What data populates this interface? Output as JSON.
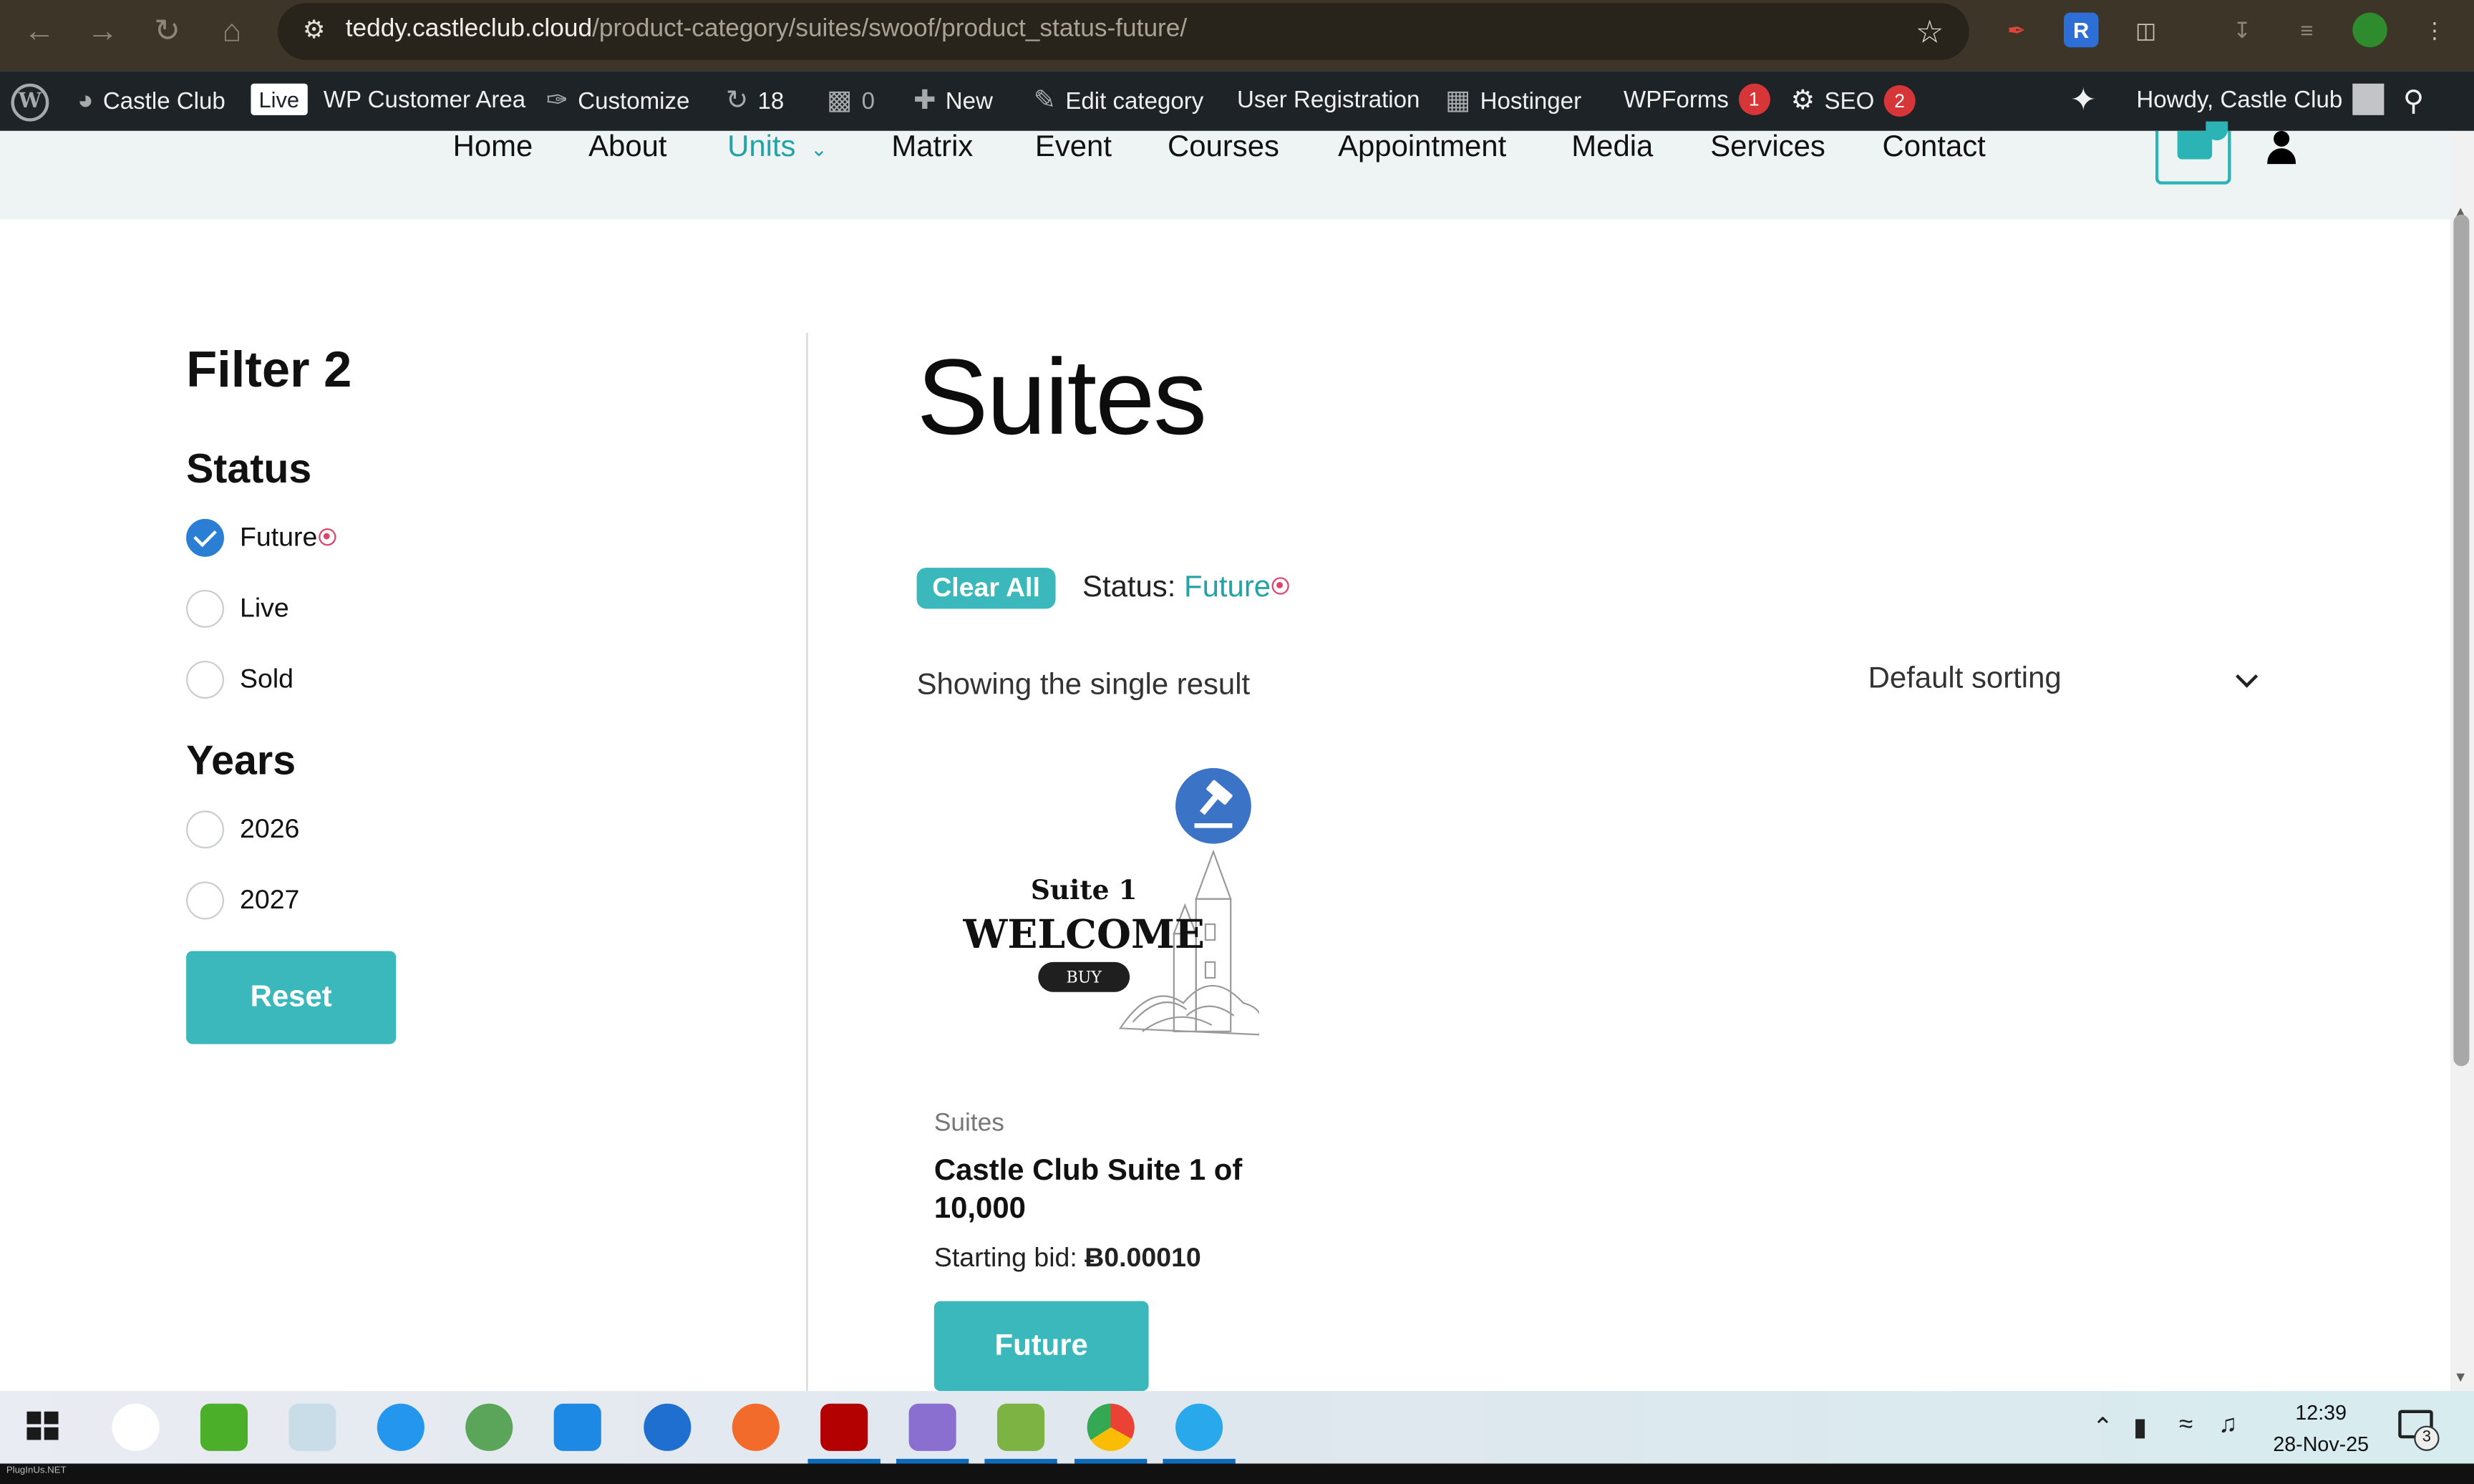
{
  "browser": {
    "url_host": "teddy.castleclub.cloud",
    "url_path": "/product-category/suites/swoof/product_status-future/"
  },
  "wp_admin_bar": {
    "site_name": "Castle Club",
    "live_badge": "Live",
    "customer_area": "WP Customer Area",
    "customize": "Customize",
    "updates_count": "18",
    "comments_count": "0",
    "new_label": "New",
    "edit_category": "Edit category",
    "user_registration": "User Registration",
    "hostinger": "Hostinger",
    "wpforms": "WPForms",
    "wpforms_badge": "1",
    "seo": "SEO",
    "seo_badge": "2",
    "howdy": "Howdy, Castle Club"
  },
  "site_nav": {
    "items": [
      "Home",
      "About",
      "Units",
      "Matrix",
      "Event",
      "Courses",
      "Appointment",
      "Media",
      "Services",
      "Contact"
    ],
    "active": "Units"
  },
  "sidebar": {
    "title": "Filter 2",
    "status_title": "Status",
    "status_options": [
      {
        "label": "Future",
        "checked": true
      },
      {
        "label": "Live",
        "checked": false
      },
      {
        "label": "Sold",
        "checked": false
      }
    ],
    "years_title": "Years",
    "year_options": [
      {
        "label": "2026",
        "checked": false
      },
      {
        "label": "2027",
        "checked": false
      }
    ],
    "reset_label": "Reset"
  },
  "main": {
    "title": "Suites",
    "clear_all": "Clear All",
    "active_filter_label": "Status:",
    "active_filter_value": "Future",
    "result_count": "Showing the single result",
    "sorting": "Default sorting"
  },
  "product": {
    "image_suite": "Suite 1",
    "image_welcome": "WELCOME",
    "image_buy": "BUY",
    "category": "Suites",
    "title": "Castle Club Suite 1 of 10,000",
    "price_label": "Starting bid:",
    "price_value": "Ƀ0.00010",
    "button": "Future"
  },
  "taskbar": {
    "time": "12:39",
    "date": "28-Nov-25",
    "notification_count": "3"
  },
  "footer_label": "PlugInUs.NET",
  "colors": {
    "accent": "#3ab8bb",
    "link": "#24a3a7",
    "checkbox": "#2a7fd4",
    "wp_bar": "#1d2327",
    "browser_bar": "#3c3528"
  }
}
